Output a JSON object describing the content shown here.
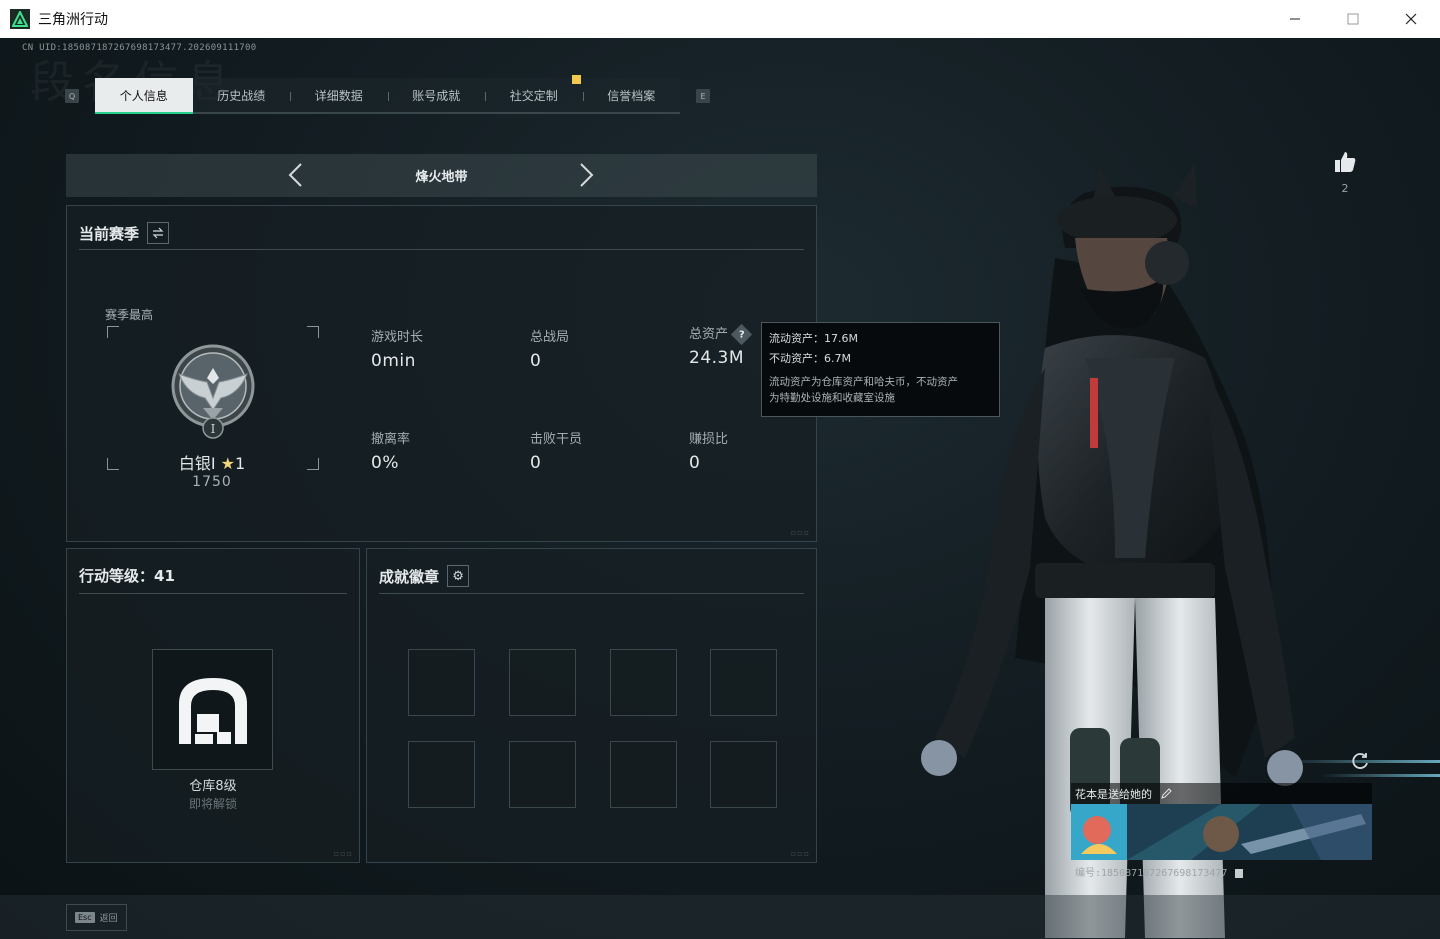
{
  "window": {
    "title": "三角洲行动",
    "controls": {
      "minimize": "—",
      "maximize": "☐",
      "close": "✕"
    }
  },
  "header": {
    "uid": "CN UID:185087187267698173477.202609111700",
    "bg_word": "段名信息",
    "tab_key_left": "Q",
    "tab_key_right": "E"
  },
  "tabs": [
    {
      "label": "个人信息",
      "active": true
    },
    {
      "label": "历史战绩",
      "active": false
    },
    {
      "label": "详细数据",
      "active": false
    },
    {
      "label": "账号成就",
      "active": false
    },
    {
      "label": "社交定制",
      "active": false
    },
    {
      "label": "信誉档案",
      "active": false
    }
  ],
  "mode": {
    "label": "烽火地带"
  },
  "season": {
    "title": "当前赛季",
    "high_label": "赛季最高",
    "rank_name": "白银I",
    "rank_stars": "1",
    "rank_score": "1750",
    "emblem_numeral": "I",
    "stats": [
      {
        "label": "游戏时长",
        "value": "0min"
      },
      {
        "label": "总战局",
        "value": "0"
      },
      {
        "label": "总资产",
        "value": "24.3M",
        "help": "?"
      },
      {
        "label": "撤离率",
        "value": "0%"
      },
      {
        "label": "击败干员",
        "value": "0"
      },
      {
        "label": "赚损比",
        "value": "0"
      }
    ]
  },
  "tooltip": {
    "liquid": "流动资产：17.6M",
    "fixed": "不动资产：6.7M",
    "desc_line1": "流动资产为仓库资产和哈夫币，不动资产",
    "desc_line2": "为特勤处设施和收藏室设施"
  },
  "level": {
    "title": "行动等级：41",
    "vault_label": "仓库8级",
    "vault_sub": "即将解锁"
  },
  "badges": {
    "title": "成就徽章",
    "slots": 8
  },
  "like": {
    "count": "2"
  },
  "card": {
    "title": "花本是送给她的",
    "serial": "编号:185087187267698173477"
  },
  "footer": {
    "esc_key": "Esc",
    "esc_label": "返回"
  },
  "colors": {
    "accent": "#25d08b",
    "tab_badge": "#f2c94c",
    "rank_star": "#f2d47a"
  }
}
